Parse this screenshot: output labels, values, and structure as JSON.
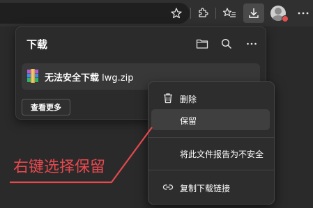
{
  "toolbar": {
    "icons": [
      "favorite-icon",
      "extensions-icon",
      "favorites-list-icon",
      "downloads-icon",
      "profile-avatar",
      "more-options-icon"
    ]
  },
  "downloads_panel": {
    "title": "下载",
    "icons": [
      "open-folder-icon",
      "search-icon",
      "more-options-icon"
    ],
    "item": {
      "status": "无法安全下载",
      "filename": "lwg.zip",
      "icon": "winrar-archive-icon"
    },
    "see_more_label": "查看更多"
  },
  "context_menu": {
    "items": [
      {
        "label": "删除",
        "icon": "trash-icon"
      },
      {
        "label": "保留",
        "icon": ""
      },
      {
        "label": "将此文件报告为不安全",
        "icon": ""
      },
      {
        "label": "复制下载链接",
        "icon": "link-icon"
      }
    ],
    "highlighted_index": 1
  },
  "annotation": {
    "text": "右键选择保留",
    "color": "#e5484d"
  }
}
